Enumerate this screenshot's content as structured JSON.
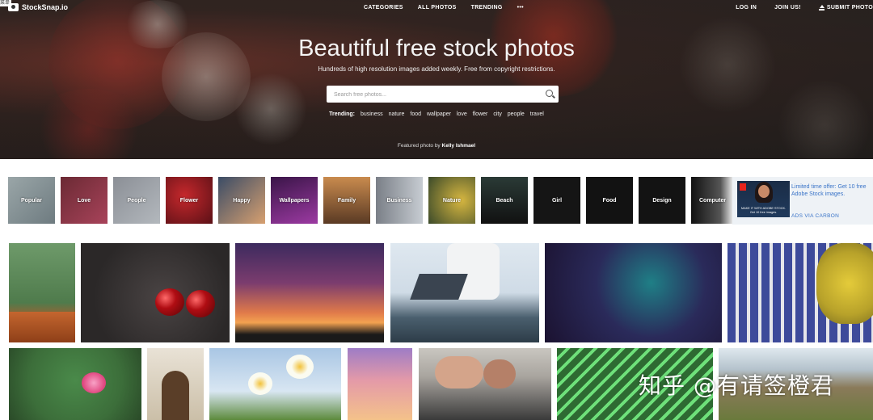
{
  "brand": {
    "name": "StockSnap.io"
  },
  "corner_badge": "菜单",
  "nav": {
    "center": [
      "CATEGORIES",
      "ALL PHOTOS",
      "TRENDING",
      "•••"
    ],
    "login": "LOG IN",
    "join": "JOIN US!",
    "submit": "SUBMIT PHOTO"
  },
  "hero": {
    "title": "Beautiful free stock photos",
    "subtitle": "Hundreds of high resolution images added weekly. Free from copyright restrictions.",
    "search_placeholder": "Search free photos...",
    "trending_label": "Trending:",
    "trending_tags": [
      "business",
      "nature",
      "food",
      "wallpaper",
      "love",
      "flower",
      "city",
      "people",
      "travel"
    ],
    "featured_prefix": "Featured photo by",
    "featured_author": "Kelly Ishmael"
  },
  "categories": [
    "Popular",
    "Love",
    "People",
    "Flower",
    "Happy",
    "Wallpapers",
    "Family",
    "Business",
    "Nature",
    "Beach",
    "Girl",
    "Food",
    "Design",
    "Computer"
  ],
  "ad": {
    "thumb_caption": "MAKE IT WITH ADOBE STOCK.\nGet 10 free images.",
    "text": "Limited time offer: Get 10 free Adobe Stock images.",
    "via": "ADS VIA CARBON"
  },
  "colors": {
    "accent_link": "#3a74c8",
    "hero_overlay": "#2a2624"
  },
  "watermark": "知乎 @有请签橙君"
}
